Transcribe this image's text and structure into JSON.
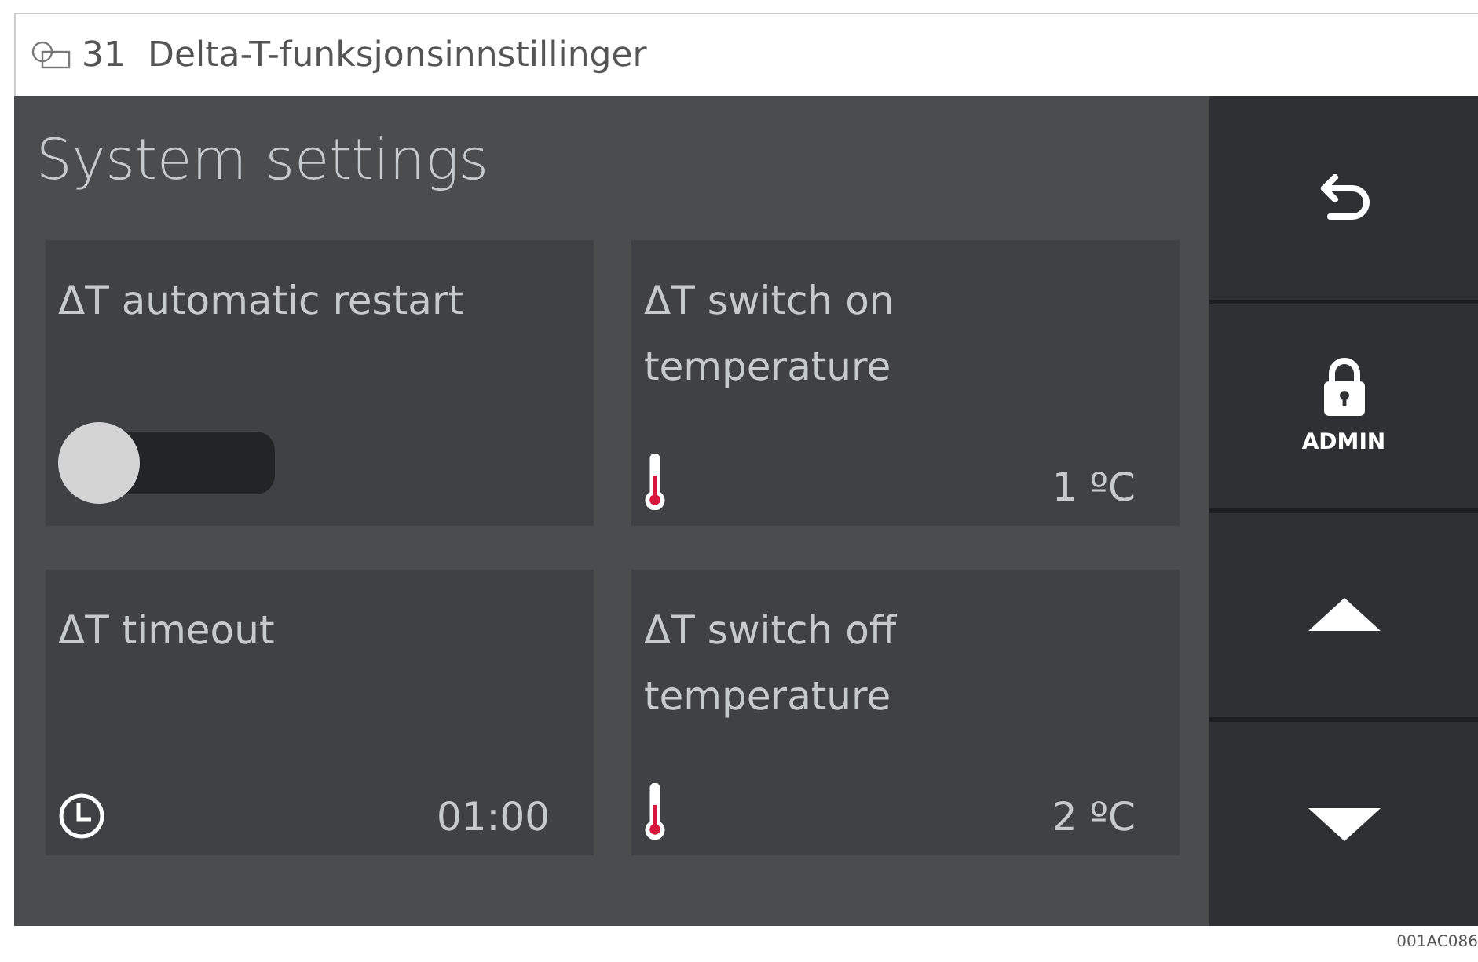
{
  "figure": {
    "number": "31",
    "caption": "Delta-T-funksjonsinnstillinger",
    "code": "001AC086"
  },
  "screen": {
    "title": "System settings"
  },
  "cards": [
    {
      "kind": "toggle",
      "label": "ΔT automatic restart",
      "on": false
    },
    {
      "kind": "temperature",
      "label": "ΔT switch on temperature",
      "value": "1 ºC"
    },
    {
      "kind": "time",
      "label": "ΔT timeout",
      "value": "01:00"
    },
    {
      "kind": "temperature",
      "label": "ΔT switch off temperature",
      "value": "2 ºC"
    }
  ],
  "sidebar": [
    {
      "kind": "back"
    },
    {
      "kind": "lock",
      "label": "ADMIN"
    },
    {
      "kind": "up"
    },
    {
      "kind": "down"
    }
  ]
}
